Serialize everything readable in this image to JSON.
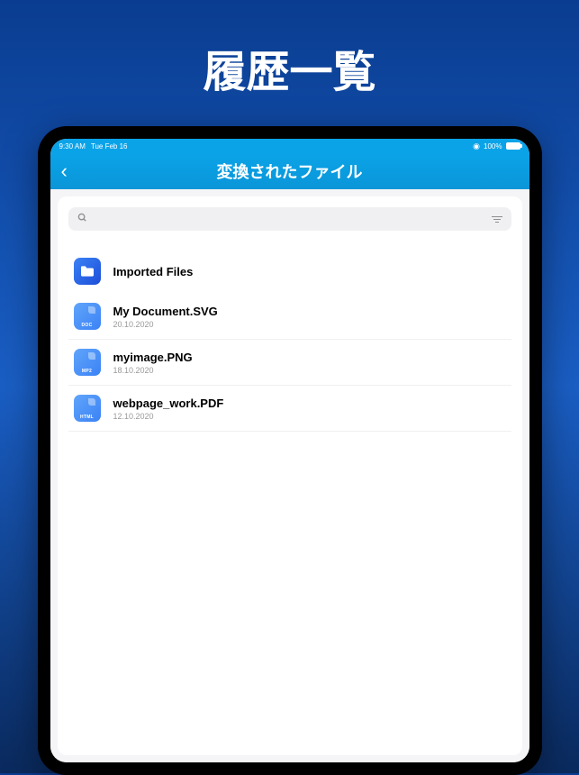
{
  "hero": {
    "title": "履歴一覧"
  },
  "statusBar": {
    "time": "9:30 AM",
    "date": "Tue Feb 16",
    "battery": "100%"
  },
  "navBar": {
    "title": "変換されたファイル"
  },
  "files": [
    {
      "name": "Imported Files",
      "type": "folder",
      "date": ""
    },
    {
      "name": "My Document.SVG",
      "type": "DOC",
      "date": "20.10.2020"
    },
    {
      "name": "myimage.PNG",
      "type": "MP2",
      "date": "18.10.2020"
    },
    {
      "name": "webpage_work.PDF",
      "type": "HTML",
      "date": "12.10.2020"
    }
  ]
}
